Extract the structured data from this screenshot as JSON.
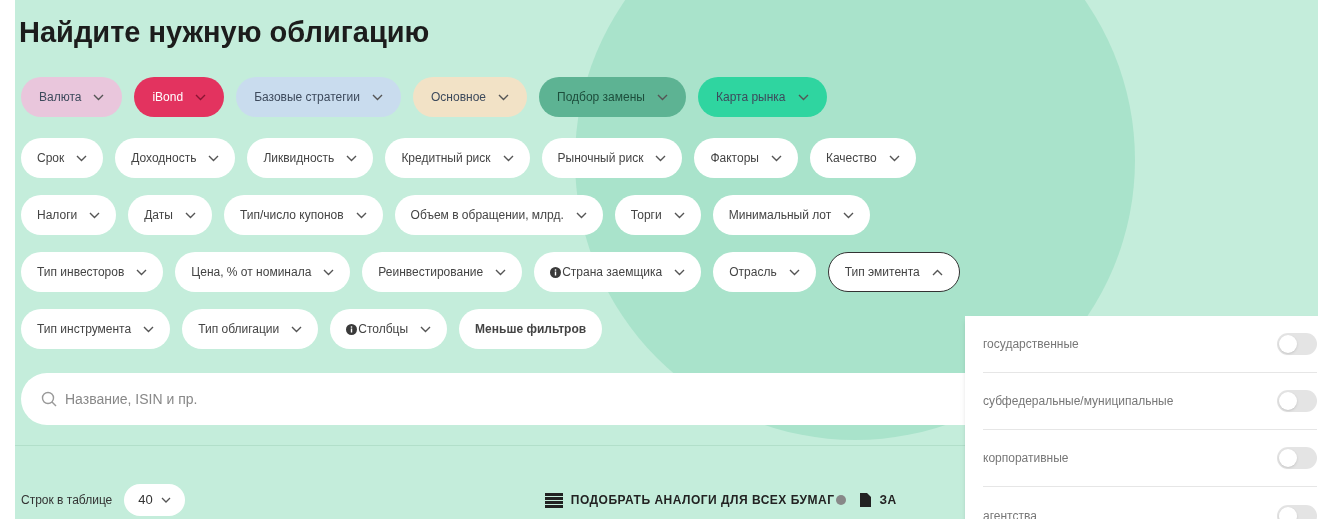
{
  "title": "Найдите нужную облигацию",
  "categories": [
    {
      "label": "Валюта",
      "color": "#e9c6dc"
    },
    {
      "label": "iBond",
      "color": "#e3335f"
    },
    {
      "label": "Базовые стратегии",
      "color": "#c9dcee"
    },
    {
      "label": "Основное",
      "color": "#f2e2c6"
    },
    {
      "label": "Подбор замены",
      "color": "#5db393"
    },
    {
      "label": "Карта рынка",
      "color": "#2fd5a0"
    }
  ],
  "filter_rows": [
    [
      {
        "label": "Срок",
        "expanded": false
      },
      {
        "label": "Доходность",
        "expanded": false
      },
      {
        "label": "Ликвидность",
        "expanded": false
      },
      {
        "label": "Кредитный риск",
        "expanded": false
      },
      {
        "label": "Рыночный риск",
        "expanded": false
      },
      {
        "label": "Факторы",
        "expanded": false
      },
      {
        "label": "Качество",
        "expanded": false
      }
    ],
    [
      {
        "label": "Налоги",
        "expanded": false
      },
      {
        "label": "Даты",
        "expanded": false
      },
      {
        "label": "Тип/число купонов",
        "expanded": false
      },
      {
        "label": "Объем в обращении, млрд.",
        "expanded": false
      },
      {
        "label": "Торги",
        "expanded": false
      },
      {
        "label": "Минимальный лот",
        "expanded": false
      }
    ],
    [
      {
        "label": "Тип инвесторов",
        "expanded": false
      },
      {
        "label": "Цена, % от номинала",
        "expanded": false
      },
      {
        "label": "Реинвестирование",
        "expanded": false
      },
      {
        "label": "Страна заемщика",
        "expanded": false,
        "kind": "info"
      },
      {
        "label": "Отрасль",
        "expanded": false
      },
      {
        "label": "Тип эмитента",
        "expanded": true
      }
    ],
    [
      {
        "label": "Тип инструмента",
        "expanded": false
      },
      {
        "label": "Тип облигации",
        "expanded": false
      },
      {
        "label": "Столбцы",
        "expanded": false,
        "kind": "info"
      },
      {
        "label": "Меньше фильтров",
        "kind": "plain"
      }
    ]
  ],
  "search": {
    "placeholder": "Название, ISIN и пр."
  },
  "rows_per_page": {
    "label": "Строк в таблице",
    "value": "40"
  },
  "actions": [
    {
      "label": "ПОДОБРАТЬ АНАЛОГИ ДЛЯ ВСЕХ БУМАГ",
      "kind": "list"
    },
    {
      "label": "ЗА",
      "kind": "doc"
    }
  ],
  "issuer_dropdown": [
    {
      "label": "государственные",
      "on": false
    },
    {
      "label": "субфедеральные/муниципальные",
      "on": false
    },
    {
      "label": "корпоративные",
      "on": false
    },
    {
      "label": "агентства",
      "on": false
    }
  ]
}
